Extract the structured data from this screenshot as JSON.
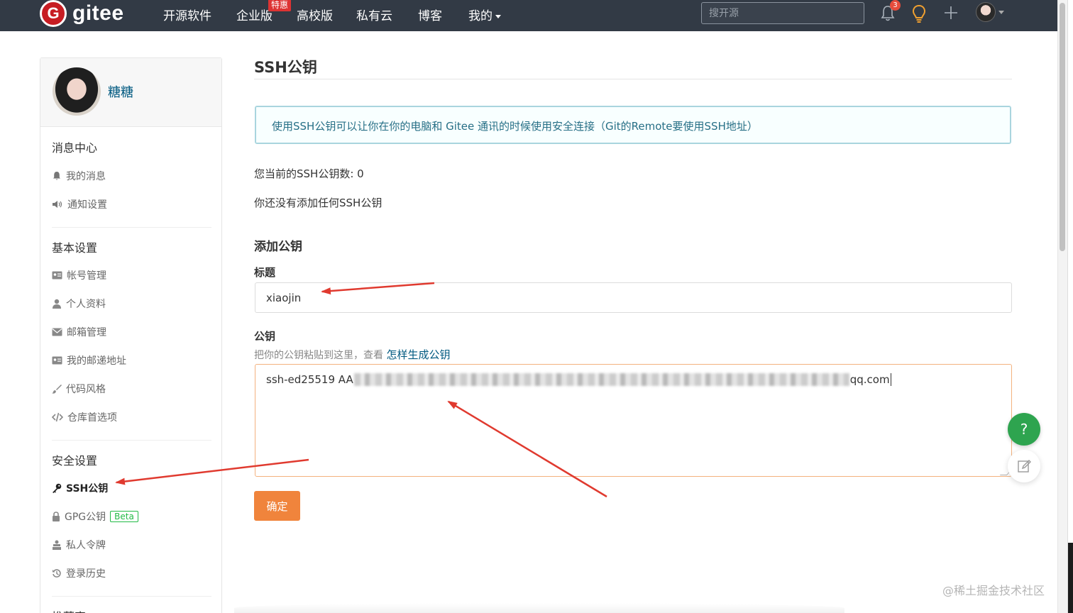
{
  "navbar": {
    "logo_mark": "G",
    "logo_text": "gitee",
    "items": [
      "开源软件",
      "企业版",
      "高校版",
      "私有云",
      "博客",
      "我的"
    ],
    "enterprise_badge": "特惠",
    "search_placeholder": "搜开源",
    "notification_count": "3",
    "icons": [
      "bell-icon",
      "bulb-icon",
      "plus-icon",
      "avatar"
    ],
    "accent": "#323a45"
  },
  "sidebar": {
    "username": "糖糖",
    "sections": {
      "messages": {
        "title": "消息中心",
        "items": [
          "我的消息",
          "通知设置"
        ]
      },
      "basic": {
        "title": "基本设置",
        "items": [
          "帐号管理",
          "个人资料",
          "邮箱管理",
          "我的邮递地址",
          "代码风格",
          "仓库首选项"
        ]
      },
      "security": {
        "title": "安全设置",
        "items": [
          "SSH公钥",
          "GPG公钥",
          "私人令牌",
          "登录历史"
        ],
        "beta_label": "Beta"
      },
      "next": {
        "title": "推荐官"
      }
    }
  },
  "main": {
    "title": "SSH公钥",
    "info": "使用SSH公钥可以让你在你的电脑和 Gitee 通讯的时候使用安全连接（Git的Remote要使用SSH地址）",
    "count_text": "您当前的SSH公钥数: 0",
    "empty_text": "你还没有添加任何SSH公钥",
    "add_heading": "添加公钥",
    "form": {
      "title_label": "标题",
      "title_value": "xiaojin",
      "key_label": "公钥",
      "key_hint": "把你的公钥粘贴到这里，查看 ",
      "key_hint_link": "怎样生成公钥",
      "key_prefix": "ssh-ed25519 AA",
      "key_suffix": "qq.com",
      "submit_label": "确定"
    }
  },
  "floating": {
    "help_label": "?"
  },
  "watermark": "@稀土掘金技术社区",
  "colors": {
    "submit": "#f0843c",
    "link": "#005980",
    "info_text": "#276f86",
    "help": "#2ea44f"
  }
}
